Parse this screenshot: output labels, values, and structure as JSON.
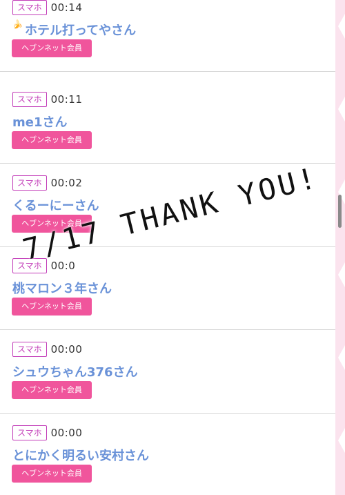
{
  "entries": [
    {
      "badge": "スマホ",
      "time": "00:14",
      "name": "ホテル打ってやさん",
      "button": "ヘブンネット会員"
    },
    {
      "badge": "スマホ",
      "time": "00:11",
      "name": "me1さん",
      "button": "ヘブンネット会員"
    },
    {
      "badge": "スマホ",
      "time": "00:02",
      "name": "くるーにーさん",
      "button": "ヘブンネット会員"
    },
    {
      "badge": "スマホ",
      "time": "00:0",
      "name": "桃マロン３年さん",
      "button": "ヘブンネット会員"
    },
    {
      "badge": "スマホ",
      "time": "00:00",
      "name": "シュウちゃん376さん",
      "button": "ヘブンネット会員"
    },
    {
      "badge": "スマホ",
      "time": "00:00",
      "name": "とにかく明るい安村さん",
      "button": "ヘブンネット会員"
    }
  ],
  "overlay_text": "7/17 THANK YOU!",
  "icons": {
    "first_entry_icon": "banana-icon"
  },
  "colors": {
    "badge": "#c23bb8",
    "name": "#6a92d8",
    "button": "#f0559c",
    "edge": "#fbe3ee"
  }
}
